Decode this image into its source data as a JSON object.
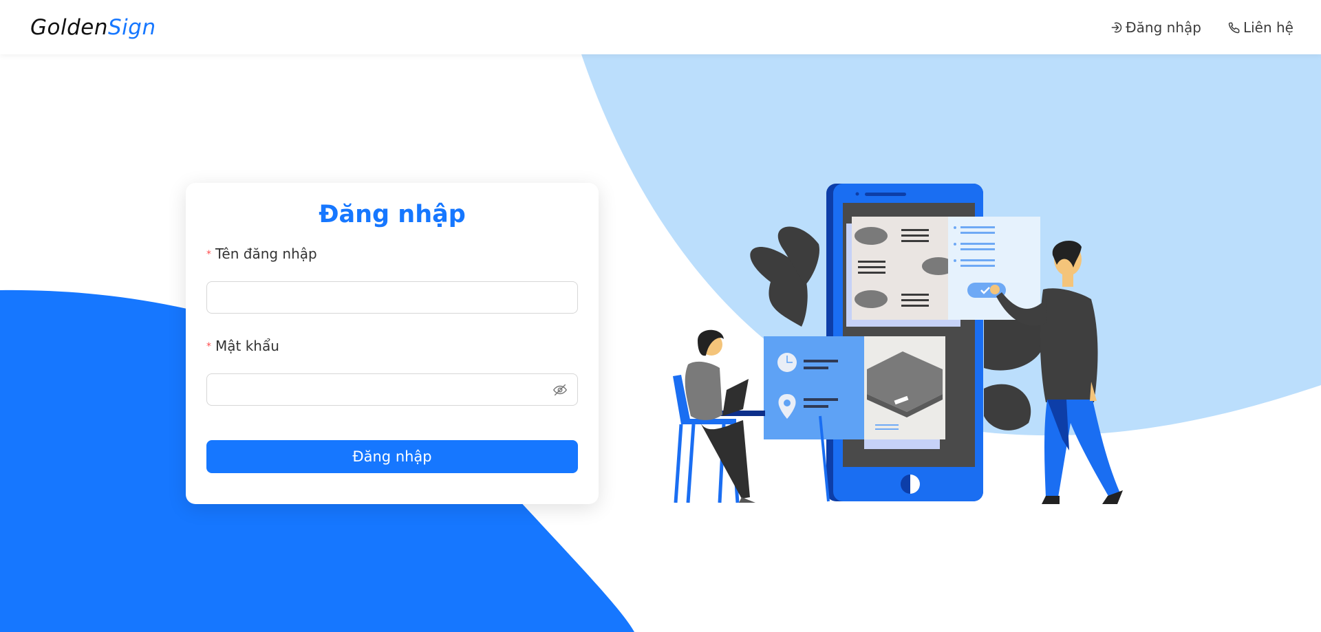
{
  "header": {
    "logo_part1": "Golden",
    "logo_part2": "Sign",
    "nav": {
      "login_label": "Đăng nhập",
      "contact_label": "Liên hệ"
    }
  },
  "login_form": {
    "title": "Đăng nhập",
    "username": {
      "label": "Tên đăng nhập",
      "required_mark": "*",
      "value": "",
      "placeholder": ""
    },
    "password": {
      "label": "Mật khẩu",
      "required_mark": "*",
      "value": "",
      "placeholder": ""
    },
    "submit_label": "Đăng nhập"
  },
  "icons": {
    "nav_login": "login-icon",
    "nav_contact": "phone-icon",
    "password_toggle": "eye-invisible-icon"
  },
  "colors": {
    "primary": "#1677ff",
    "light_blue": "#bbdefc",
    "required": "#ff4d4f"
  }
}
